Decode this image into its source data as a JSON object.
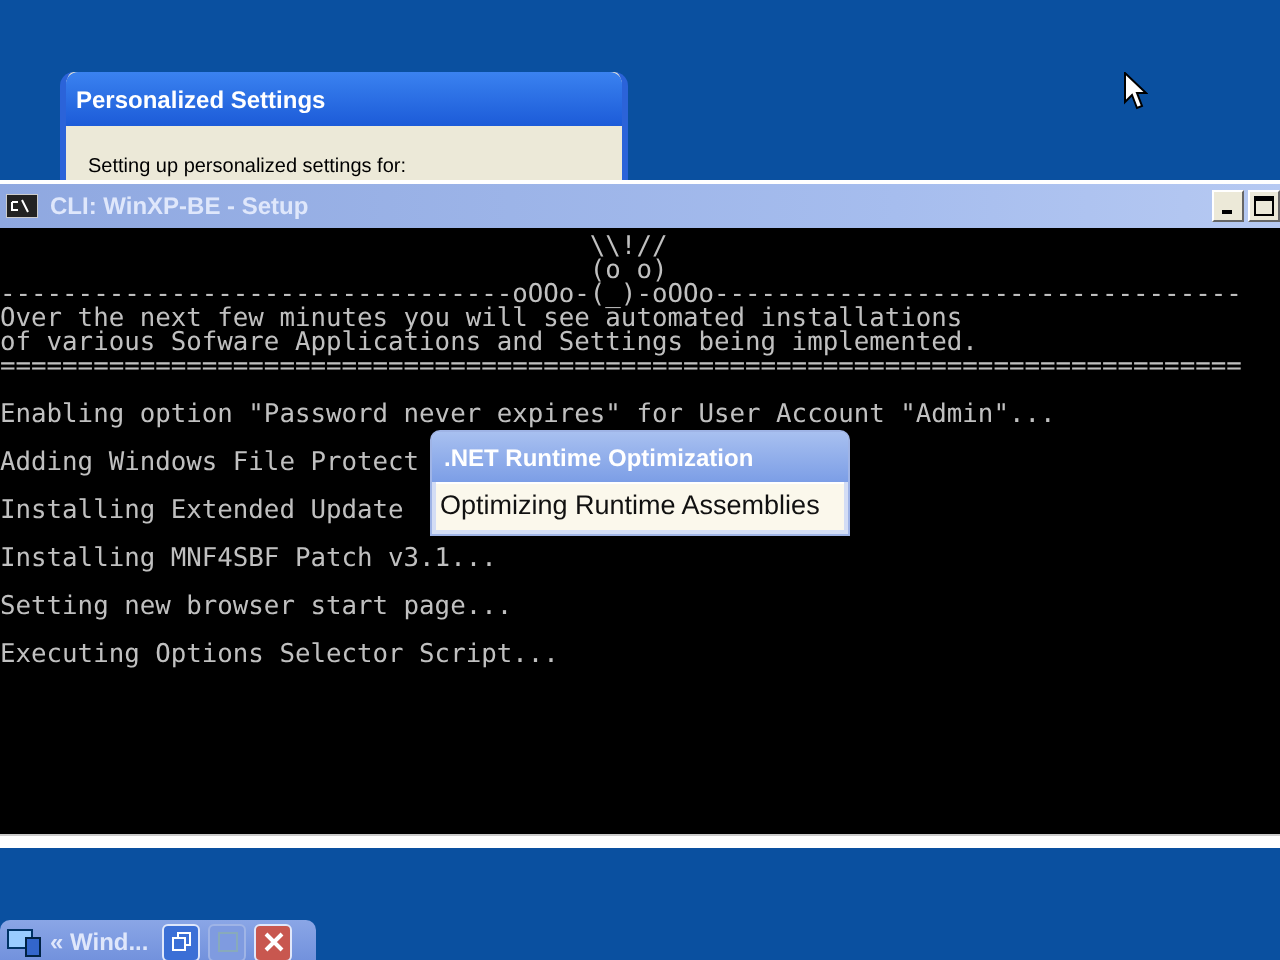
{
  "background_window": {
    "title": "Personalized Settings",
    "message": "Setting up personalized settings for:"
  },
  "console_window": {
    "title": "CLI: WinXP-BE - Setup",
    "lines": [
      {
        "kind": "banner",
        "text": "                                      \\\\!//"
      },
      {
        "kind": "banner",
        "text": "                                      (o o)"
      },
      {
        "kind": "banner",
        "text": "---------------------------------oOOo-(_)-oOOo----------------------------------"
      },
      {
        "kind": "banner",
        "text": "Over the next few minutes you will see automated installations"
      },
      {
        "kind": "banner",
        "text": "of various Sofware Applications and Settings being implemented."
      },
      {
        "kind": "banner",
        "text": "================================================================================"
      },
      {
        "kind": "step",
        "text": "Enabling option \"Password never expires\" for User Account \"Admin\"..."
      },
      {
        "kind": "step",
        "text": "Adding Windows File Protect"
      },
      {
        "kind": "step",
        "text": "Installing Extended Update"
      },
      {
        "kind": "step",
        "text": "Installing MNF4SBF Patch v3.1..."
      },
      {
        "kind": "step",
        "text": "Setting new browser start page..."
      },
      {
        "kind": "step",
        "text": "Executing Options Selector Script..."
      }
    ]
  },
  "popup": {
    "title": ".NET Runtime Optimization",
    "message": "Optimizing Runtime Assemblies"
  },
  "minimized_window": {
    "title": "« Wind..."
  }
}
